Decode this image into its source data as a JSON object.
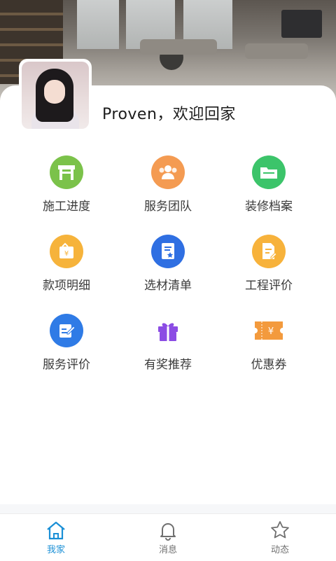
{
  "header": {
    "welcome_text": "Proven，欢迎回家"
  },
  "menu": {
    "items": [
      {
        "label": "施工进度",
        "icon": "construction-barrier-icon",
        "color": "#7bc24a"
      },
      {
        "label": "服务团队",
        "icon": "team-people-icon",
        "color": "#f49b52"
      },
      {
        "label": "装修档案",
        "icon": "folder-icon",
        "color": "#3cc46a"
      },
      {
        "label": "款项明细",
        "icon": "wallet-yuan-icon",
        "color": "#f6b33b"
      },
      {
        "label": "选材清单",
        "icon": "document-star-icon",
        "color": "#2f6fe2"
      },
      {
        "label": "工程评价",
        "icon": "edit-document-icon",
        "color": "#f7b23b"
      },
      {
        "label": "服务评价",
        "icon": "pen-on-document-icon",
        "color": "#2f7be6"
      },
      {
        "label": "有奖推荐",
        "icon": "gift-icon",
        "color": "#8b4ce4"
      },
      {
        "label": "优惠券",
        "icon": "coupon-yuan-icon",
        "color": "#f39a3d"
      }
    ]
  },
  "tabbar": {
    "items": [
      {
        "label": "我家",
        "icon": "home-icon",
        "active": true
      },
      {
        "label": "消息",
        "icon": "bell-icon",
        "active": false
      },
      {
        "label": "动态",
        "icon": "star-icon",
        "active": false
      }
    ],
    "active_color": "#1a8fd6"
  }
}
